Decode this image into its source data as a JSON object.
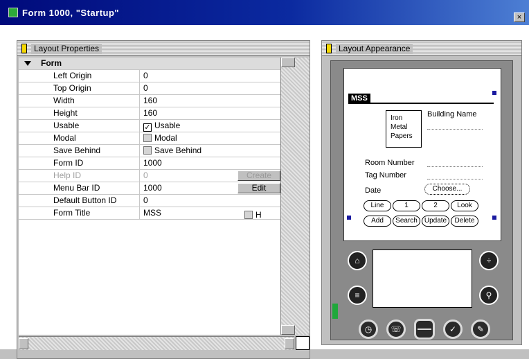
{
  "window": {
    "title": "Form 1000, \"Startup\"",
    "close_label": "×"
  },
  "properties_panel": {
    "title": "Layout Properties",
    "group": "Form",
    "rows": [
      {
        "name": "Left Origin",
        "value": "0",
        "kind": "text"
      },
      {
        "name": "Top Origin",
        "value": "0",
        "kind": "text"
      },
      {
        "name": "Width",
        "value": "160",
        "kind": "text"
      },
      {
        "name": "Height",
        "value": "160",
        "kind": "text"
      },
      {
        "name": "Usable",
        "value": "Usable",
        "kind": "checkbox",
        "checked": true
      },
      {
        "name": "Modal",
        "value": "Modal",
        "kind": "checkbox",
        "checked": false
      },
      {
        "name": "Save Behind",
        "value": "Save Behind",
        "kind": "checkbox",
        "checked": false
      },
      {
        "name": "Form ID",
        "value": "1000",
        "kind": "text"
      },
      {
        "name": "Help ID",
        "value": "0",
        "kind": "button",
        "button": "Create",
        "disabled": true
      },
      {
        "name": "Menu Bar ID",
        "value": "1000",
        "kind": "button",
        "button": "Edit",
        "disabled": false
      },
      {
        "name": "Default Button ID",
        "value": "0",
        "kind": "text"
      },
      {
        "name": "Form Title",
        "value": "MSS",
        "kind": "title",
        "suffix": "H"
      }
    ]
  },
  "layout_panel": {
    "title": "Layout Appearance",
    "form_title": "MSS",
    "list_items": [
      "Iron",
      "Metal",
      "Papers"
    ],
    "labels": {
      "building_name": "Building Name",
      "room_number": "Room Number",
      "tag_number": "Tag Number",
      "date": "Date",
      "choose": "Choose..."
    },
    "row1_buttons": [
      "Line",
      "1",
      "2",
      "Look"
    ],
    "row2_buttons": [
      "Add",
      "Search",
      "Update",
      "Delete"
    ],
    "hw_buttons": [
      "date-book",
      "address",
      "scroll",
      "todo",
      "memo"
    ]
  }
}
